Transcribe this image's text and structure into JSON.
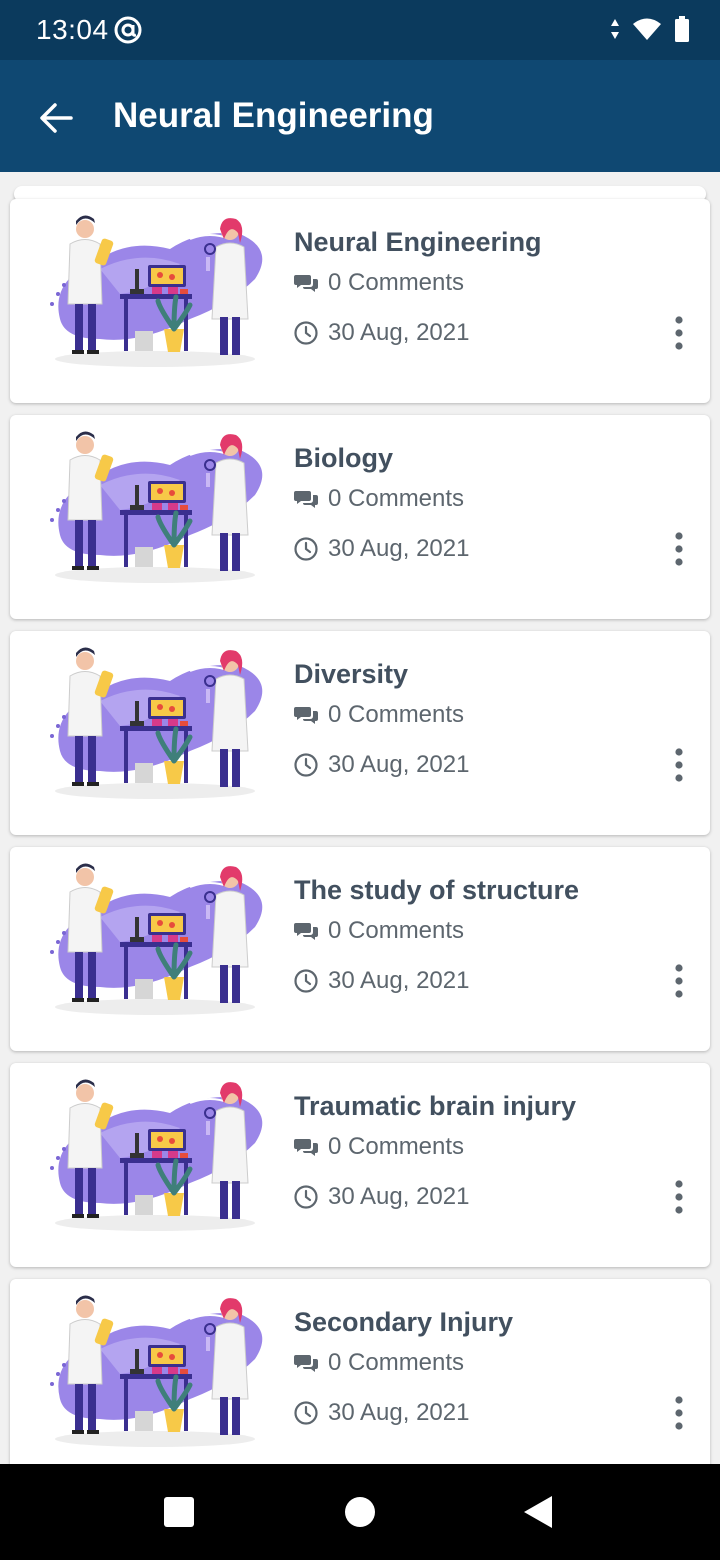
{
  "status_bar": {
    "time": "13:04"
  },
  "app_bar": {
    "title": "Neural Engineering"
  },
  "colors": {
    "status_bar": "#0b3a5d",
    "app_bar": "#0f4872",
    "title_text": "#42505f",
    "meta_text": "#5d666e"
  },
  "posts": [
    {
      "title": "Neural Engineering",
      "comments": "0 Comments",
      "date": "30 Aug, 2021"
    },
    {
      "title": "Biology",
      "comments": "0 Comments",
      "date": "30 Aug, 2021"
    },
    {
      "title": "Diversity",
      "comments": "0 Comments",
      "date": "30 Aug, 2021"
    },
    {
      "title": "The study of structure",
      "comments": "0 Comments",
      "date": "30 Aug, 2021"
    },
    {
      "title": "Traumatic brain injury",
      "comments": "0 Comments",
      "date": "30 Aug, 2021"
    },
    {
      "title": "Secondary Injury",
      "comments": "0 Comments",
      "date": "30 Aug, 2021"
    }
  ],
  "icons": {
    "back": "arrow-left-icon",
    "comments": "comments-icon",
    "date": "clock-icon",
    "more": "more-vert-icon",
    "thumbnail": "scientists-illustration"
  }
}
